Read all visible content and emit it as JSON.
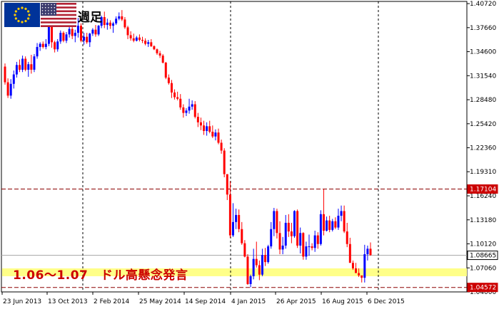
{
  "header": {
    "flag_left": "eu-flag-icon",
    "flag_right": "us-flag-icon",
    "timeframe_label": "週足"
  },
  "annotation": {
    "band_text": "1.06〜1.07　ドル高懸念発言"
  },
  "colors": {
    "bull": "#0000ff",
    "bear": "#ff0000",
    "band": "#ffff88",
    "hline": "#8b0000",
    "price_tag_red": "#cc0000"
  },
  "chart_data": {
    "type": "candlestick",
    "symbol": "EURUSD",
    "timeframe": "weekly",
    "ylim": [
      1.04,
      1.41
    ],
    "y_ticks": [
      "1.40720",
      "1.37660",
      "1.34600",
      "1.31540",
      "1.28480",
      "1.25420",
      "1.22360",
      "1.19310",
      "1.16240",
      "1.13180",
      "1.10120",
      "1.07060",
      "1.04000"
    ],
    "x_ticks": [
      "23 Jun 2013",
      "13 Oct 2013",
      "2 Feb 2014",
      "25 May 2014",
      "14 Sep 2014",
      "4 Jan 2015",
      "26 Apr 2015",
      "16 Aug 2015",
      "6 Dec 2015"
    ],
    "price_labels": [
      {
        "text": "1.17104",
        "value": 1.17104,
        "style": "red"
      },
      {
        "text": "1.08665",
        "value": 1.08665,
        "style": "white"
      },
      {
        "text": "1.04572",
        "value": 1.04572,
        "style": "red"
      }
    ],
    "horizontal_lines": [
      1.17104,
      1.04572
    ],
    "current_price": 1.08665,
    "band": [
      1.06,
      1.07
    ],
    "vertical_lines_at": [
      "2 Feb 2014",
      "4 Jan 2015",
      "6 Dec 2015"
    ],
    "series": [
      {
        "name": "EURUSD",
        "ohlc": [
          [
            1.327,
            1.331,
            1.304,
            1.307
          ],
          [
            1.307,
            1.312,
            1.287,
            1.29
          ],
          [
            1.29,
            1.311,
            1.286,
            1.305
          ],
          [
            1.305,
            1.322,
            1.299,
            1.317
          ],
          [
            1.317,
            1.333,
            1.313,
            1.329
          ],
          [
            1.329,
            1.336,
            1.32,
            1.323
          ],
          [
            1.323,
            1.341,
            1.32,
            1.337
          ],
          [
            1.337,
            1.34,
            1.321,
            1.323
          ],
          [
            1.323,
            1.333,
            1.314,
            1.33
          ],
          [
            1.33,
            1.342,
            1.318,
            1.323
          ],
          [
            1.323,
            1.343,
            1.32,
            1.34
          ],
          [
            1.34,
            1.357,
            1.337,
            1.352
          ],
          [
            1.352,
            1.358,
            1.347,
            1.356
          ],
          [
            1.356,
            1.359,
            1.35,
            1.352
          ],
          [
            1.352,
            1.362,
            1.349,
            1.356
          ],
          [
            1.356,
            1.383,
            1.353,
            1.379
          ],
          [
            1.379,
            1.38,
            1.351,
            1.358
          ],
          [
            1.358,
            1.36,
            1.345,
            1.349
          ],
          [
            1.349,
            1.362,
            1.346,
            1.359
          ],
          [
            1.359,
            1.373,
            1.356,
            1.37
          ],
          [
            1.37,
            1.372,
            1.358,
            1.36
          ],
          [
            1.36,
            1.371,
            1.357,
            1.368
          ],
          [
            1.368,
            1.38,
            1.364,
            1.375
          ],
          [
            1.375,
            1.378,
            1.362,
            1.366
          ],
          [
            1.366,
            1.374,
            1.358,
            1.37
          ],
          [
            1.37,
            1.389,
            1.364,
            1.379
          ],
          [
            1.379,
            1.382,
            1.358,
            1.36
          ],
          [
            1.36,
            1.37,
            1.355,
            1.365
          ],
          [
            1.365,
            1.37,
            1.356,
            1.358
          ],
          [
            1.358,
            1.37,
            1.352,
            1.369
          ],
          [
            1.369,
            1.376,
            1.366,
            1.374
          ],
          [
            1.374,
            1.38,
            1.365,
            1.368
          ],
          [
            1.368,
            1.38,
            1.366,
            1.379
          ],
          [
            1.379,
            1.392,
            1.376,
            1.39
          ],
          [
            1.39,
            1.397,
            1.376,
            1.38
          ],
          [
            1.38,
            1.388,
            1.374,
            1.383
          ],
          [
            1.383,
            1.386,
            1.375,
            1.379
          ],
          [
            1.379,
            1.384,
            1.37,
            1.382
          ],
          [
            1.382,
            1.391,
            1.38,
            1.388
          ],
          [
            1.388,
            1.396,
            1.386,
            1.391
          ],
          [
            1.391,
            1.399,
            1.385,
            1.387
          ],
          [
            1.387,
            1.39,
            1.375,
            1.377
          ],
          [
            1.377,
            1.379,
            1.362,
            1.367
          ],
          [
            1.367,
            1.372,
            1.36,
            1.363
          ],
          [
            1.363,
            1.369,
            1.358,
            1.36
          ],
          [
            1.36,
            1.366,
            1.359,
            1.364
          ],
          [
            1.364,
            1.368,
            1.359,
            1.361
          ],
          [
            1.361,
            1.365,
            1.357,
            1.36
          ],
          [
            1.36,
            1.363,
            1.354,
            1.356
          ],
          [
            1.356,
            1.361,
            1.352,
            1.358
          ],
          [
            1.358,
            1.362,
            1.352,
            1.353
          ],
          [
            1.353,
            1.354,
            1.348,
            1.349
          ],
          [
            1.349,
            1.35,
            1.342,
            1.344
          ],
          [
            1.344,
            1.347,
            1.338,
            1.341
          ],
          [
            1.341,
            1.343,
            1.331,
            1.332
          ],
          [
            1.332,
            1.333,
            1.311,
            1.313
          ],
          [
            1.313,
            1.317,
            1.304,
            1.306
          ],
          [
            1.306,
            1.31,
            1.287,
            1.294
          ],
          [
            1.294,
            1.298,
            1.285,
            1.288
          ],
          [
            1.288,
            1.295,
            1.284,
            1.286
          ],
          [
            1.286,
            1.292,
            1.272,
            1.275
          ],
          [
            1.275,
            1.279,
            1.262,
            1.268
          ],
          [
            1.268,
            1.274,
            1.264,
            1.271
          ],
          [
            1.271,
            1.286,
            1.267,
            1.276
          ],
          [
            1.276,
            1.284,
            1.272,
            1.279
          ],
          [
            1.279,
            1.283,
            1.261,
            1.263
          ],
          [
            1.263,
            1.268,
            1.25,
            1.256
          ],
          [
            1.256,
            1.262,
            1.246,
            1.252
          ],
          [
            1.252,
            1.258,
            1.24,
            1.245
          ],
          [
            1.245,
            1.256,
            1.239,
            1.251
          ],
          [
            1.251,
            1.258,
            1.242,
            1.244
          ],
          [
            1.244,
            1.252,
            1.236,
            1.238
          ],
          [
            1.238,
            1.247,
            1.233,
            1.243
          ],
          [
            1.243,
            1.248,
            1.228,
            1.23
          ],
          [
            1.23,
            1.234,
            1.216,
            1.22
          ],
          [
            1.22,
            1.223,
            1.186,
            1.19
          ],
          [
            1.19,
            1.19,
            1.157,
            1.164
          ],
          [
            1.164,
            1.181,
            1.109,
            1.112
          ],
          [
            1.112,
            1.153,
            1.11,
            1.129
          ],
          [
            1.129,
            1.146,
            1.12,
            1.138
          ],
          [
            1.138,
            1.145,
            1.116,
            1.12
          ],
          [
            1.12,
            1.129,
            1.1,
            1.102
          ],
          [
            1.102,
            1.106,
            1.084,
            1.085
          ],
          [
            1.085,
            1.088,
            1.049,
            1.05
          ],
          [
            1.05,
            1.062,
            1.046,
            1.06
          ],
          [
            1.06,
            1.095,
            1.056,
            1.082
          ],
          [
            1.082,
            1.104,
            1.071,
            1.074
          ],
          [
            1.074,
            1.08,
            1.055,
            1.062
          ],
          [
            1.062,
            1.095,
            1.06,
            1.087
          ],
          [
            1.087,
            1.096,
            1.073,
            1.078
          ],
          [
            1.078,
            1.1,
            1.076,
            1.098
          ],
          [
            1.098,
            1.129,
            1.095,
            1.12
          ],
          [
            1.12,
            1.147,
            1.111,
            1.143
          ],
          [
            1.143,
            1.146,
            1.108,
            1.115
          ],
          [
            1.115,
            1.13,
            1.088,
            1.094
          ],
          [
            1.094,
            1.11,
            1.088,
            1.099
          ],
          [
            1.099,
            1.138,
            1.095,
            1.128
          ],
          [
            1.128,
            1.139,
            1.11,
            1.117
          ],
          [
            1.117,
            1.128,
            1.102,
            1.111
          ],
          [
            1.111,
            1.144,
            1.109,
            1.143
          ],
          [
            1.143,
            1.145,
            1.096,
            1.099
          ],
          [
            1.099,
            1.122,
            1.089,
            1.115
          ],
          [
            1.115,
            1.116,
            1.081,
            1.085
          ],
          [
            1.085,
            1.104,
            1.081,
            1.098
          ],
          [
            1.098,
            1.113,
            1.086,
            1.098
          ],
          [
            1.098,
            1.102,
            1.093,
            1.096
          ],
          [
            1.096,
            1.118,
            1.091,
            1.112
          ],
          [
            1.112,
            1.116,
            1.095,
            1.101
          ],
          [
            1.101,
            1.144,
            1.099,
            1.139
          ],
          [
            1.139,
            1.171,
            1.112,
            1.118
          ],
          [
            1.118,
            1.136,
            1.117,
            1.131
          ],
          [
            1.131,
            1.137,
            1.116,
            1.119
          ],
          [
            1.119,
            1.133,
            1.117,
            1.13
          ],
          [
            1.13,
            1.135,
            1.12,
            1.122
          ],
          [
            1.122,
            1.146,
            1.119,
            1.137
          ],
          [
            1.137,
            1.15,
            1.13,
            1.143
          ],
          [
            1.143,
            1.15,
            1.115,
            1.117
          ],
          [
            1.117,
            1.128,
            1.097,
            1.101
          ],
          [
            1.101,
            1.109,
            1.077,
            1.077
          ],
          [
            1.077,
            1.08,
            1.068,
            1.07
          ],
          [
            1.07,
            1.077,
            1.064,
            1.064
          ],
          [
            1.064,
            1.07,
            1.059,
            1.061
          ],
          [
            1.061,
            1.061,
            1.052,
            1.058
          ],
          [
            1.058,
            1.1,
            1.052,
            1.088
          ],
          [
            1.088,
            1.099,
            1.08,
            1.095
          ],
          [
            1.095,
            1.103,
            1.086,
            1.087
          ]
        ]
      }
    ]
  }
}
